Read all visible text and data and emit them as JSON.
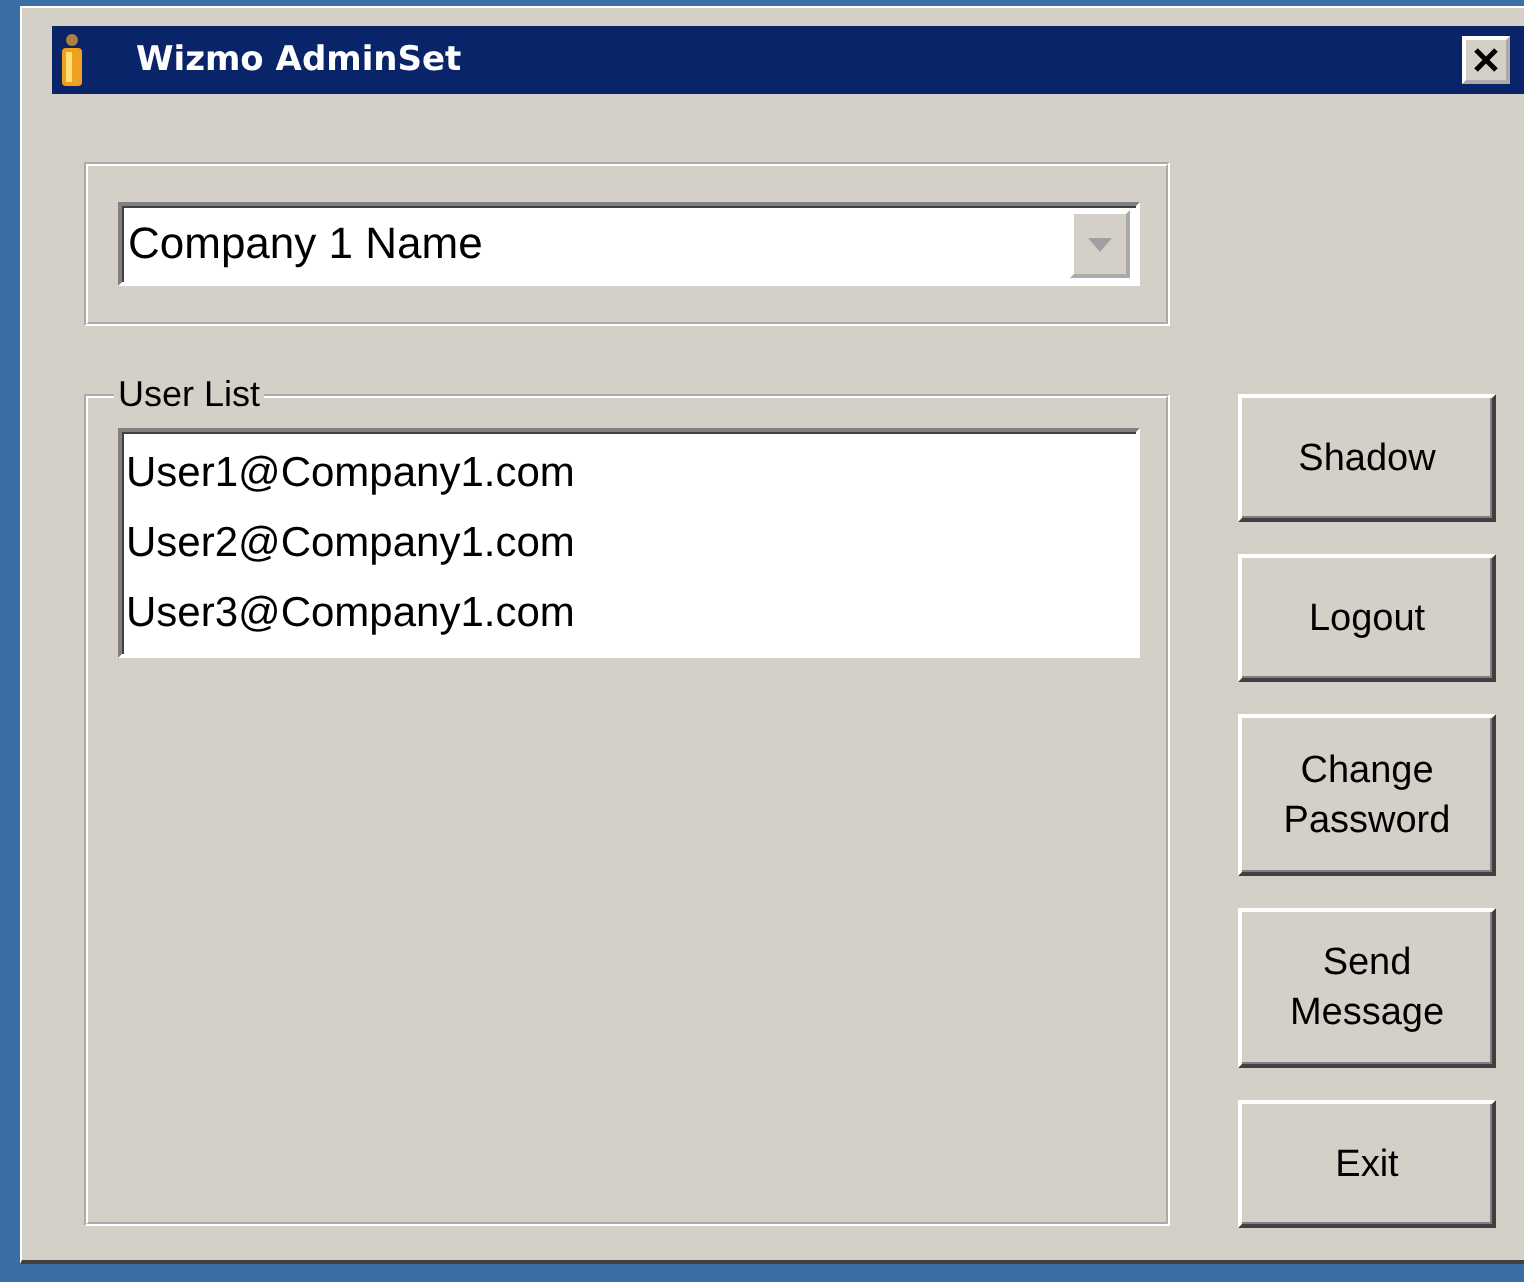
{
  "window": {
    "title": "Wizmo AdminSet"
  },
  "company_select": {
    "value": "Company 1 Name"
  },
  "user_list": {
    "label": "User List",
    "items": [
      {
        "text": "User1@Company1.com"
      },
      {
        "text": "User2@Company1.com"
      },
      {
        "text": "User3@Company1.com"
      }
    ]
  },
  "buttons": [
    {
      "label": "Shadow"
    },
    {
      "label": "Logout"
    },
    {
      "label": "Change Password"
    },
    {
      "label": "Send Message"
    },
    {
      "label": "Exit"
    }
  ]
}
